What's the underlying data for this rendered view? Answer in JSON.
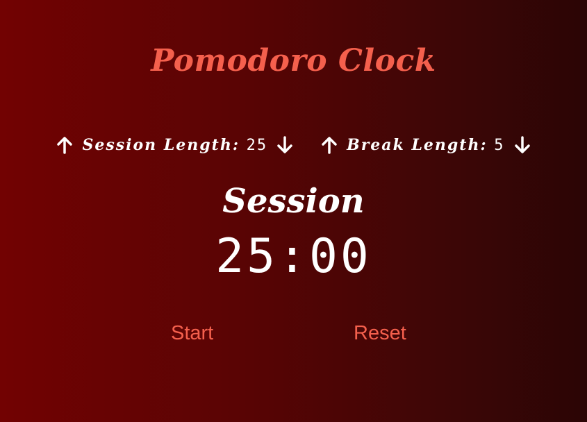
{
  "app": {
    "title": "Pomodoro Clock"
  },
  "session_control": {
    "label": "Session Length:",
    "value": "25",
    "increment_icon": "arrow-up-icon",
    "decrement_icon": "arrow-down-icon"
  },
  "break_control": {
    "label": "Break Length:",
    "value": "5",
    "increment_icon": "arrow-up-icon",
    "decrement_icon": "arrow-down-icon"
  },
  "timer": {
    "label": "Session",
    "time": "25:00"
  },
  "buttons": {
    "start": "Start",
    "reset": "Reset"
  },
  "colors": {
    "accent": "#f5604d",
    "background_left": "#720202",
    "background_right": "#2b0505",
    "text": "#ffffff"
  }
}
